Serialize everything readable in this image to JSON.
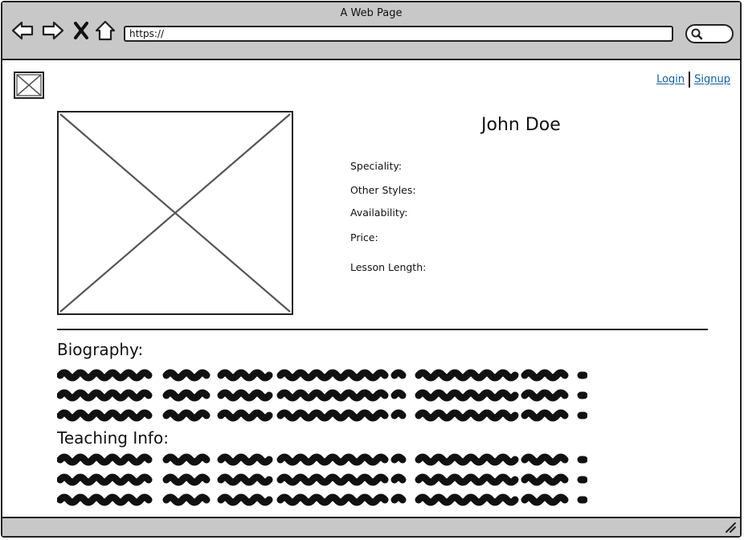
{
  "window": {
    "title": "A Web Page"
  },
  "toolbar": {
    "url": "https://",
    "back_icon": "back-arrow-icon",
    "forward_icon": "forward-arrow-icon",
    "stop_icon": "close-icon",
    "home_icon": "home-icon",
    "search_icon": "search-icon"
  },
  "header": {
    "logo_icon": "image-placeholder-icon",
    "login_label": "Login",
    "signup_label": "Signup"
  },
  "profile": {
    "name": "John Doe",
    "photo_icon": "image-placeholder-icon",
    "fields": {
      "speciality": "Speciality:",
      "other_styles": "Other Styles:",
      "availability": "Availability:",
      "price": "Price:",
      "lesson_length": "Lesson Length:"
    }
  },
  "sections": {
    "biography_title": "Biography:",
    "teaching_title": "Teaching Info:"
  },
  "colors": {
    "frame": "#222222",
    "chrome": "#c8c8c8",
    "link": "#0b5cad"
  }
}
